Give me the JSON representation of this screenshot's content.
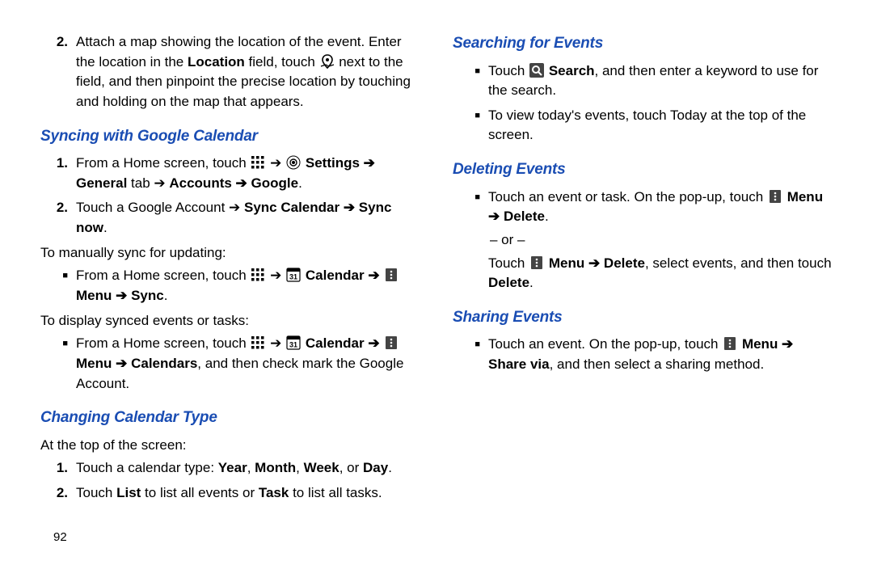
{
  "page_number": "92",
  "left": {
    "step2": {
      "num": "2.",
      "pre": "Attach a map showing the location of the event. Enter the location in the ",
      "b1": "Location",
      "mid": " field, touch ",
      "post": " next to the field, and then pinpoint the precise location by touching and holding on the map that appears."
    },
    "h1": "Syncing with Google Calendar",
    "sync1": {
      "num": "1.",
      "pre": "From a Home screen, touch ",
      "arrow": " ➔ ",
      "settings": "Settings",
      "arr2": " ➔ ",
      "general": "General",
      "tab": " tab ➔ ",
      "accounts": "Accounts",
      "arr3": " ➔ ",
      "google": "Google",
      "dot": "."
    },
    "sync2": {
      "num": "2.",
      "pre": "Touch a Google Account ➔ ",
      "b1": "Sync Calendar",
      "arr": " ➔ ",
      "b2": "Sync now",
      "dot": "."
    },
    "manual_intro": "To manually sync for updating:",
    "manual_item": {
      "pre": "From a Home screen, touch ",
      "arr1": " ➔ ",
      "cal": "Calendar",
      "arr2": " ➔ ",
      "menu": "Menu",
      "arr3": " ➔ ",
      "sync": "Sync",
      "dot": "."
    },
    "display_intro": "To display synced events or tasks:",
    "display_item": {
      "pre": "From a Home screen, touch ",
      "arr1": " ➔ ",
      "cal": "Calendar",
      "arr2": " ➔ ",
      "menu": "Menu",
      "arr3": " ➔ ",
      "calendars": "Calendars",
      "post": ", and then check mark the Google Account."
    },
    "h2": "Changing Calendar Type",
    "cct_intro": "At the top of the screen:",
    "cct1": {
      "num": "1.",
      "pre": "Touch a calendar type: ",
      "y": "Year",
      "c1": ", ",
      "m": "Month",
      "c2": ", ",
      "w": "Week",
      "c3": ", or ",
      "d": "Day",
      "dot": "."
    },
    "cct2": {
      "num": "2.",
      "pre": "Touch ",
      "list": "List",
      "mid": " to list all events or ",
      "task": "Task",
      "post": " to list all tasks."
    }
  },
  "right": {
    "h1": "Searching for Events",
    "s1": {
      "pre": "Touch ",
      "search": "Search",
      "post": ", and then enter a keyword to use for the search."
    },
    "s2": "To view today's events, touch Today at the top of the screen.",
    "h2": "Deleting Events",
    "d1": {
      "pre": "Touch an event or task. On the pop-up, touch ",
      "menu": "Menu",
      "arr": " ➔ ",
      "del": "Delete",
      "dot": ".",
      "or": "– or –",
      "pre2": "Touch ",
      "menu2": "Menu",
      "arr2": " ➔ ",
      "del2": "Delete",
      "mid": ", select events, and then touch ",
      "del3": "Delete",
      "dot2": "."
    },
    "h3": "Sharing Events",
    "sh1": {
      "pre": "Touch an event. On the pop-up, touch ",
      "menu": "Menu",
      "arr": " ➔ ",
      "share": "Share via",
      "post": ", and then select a sharing method."
    }
  }
}
